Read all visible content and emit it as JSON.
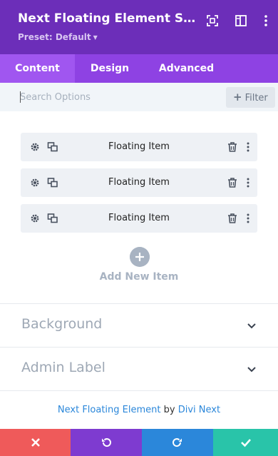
{
  "header": {
    "title": "Next Floating Element Settings",
    "preset": "Preset: Default",
    "icons": [
      "expand-icon",
      "sidebar-toggle-icon",
      "more-vertical-icon"
    ]
  },
  "tabs": [
    {
      "label": "Content",
      "active": true
    },
    {
      "label": "Design",
      "active": false
    },
    {
      "label": "Advanced",
      "active": false
    }
  ],
  "search": {
    "placeholder": "Search Options",
    "value": "",
    "filter_label": "Filter"
  },
  "items": [
    {
      "label": "Floating Item"
    },
    {
      "label": "Floating Item"
    },
    {
      "label": "Floating Item"
    }
  ],
  "add_new": {
    "label": "Add New Item"
  },
  "sections": [
    {
      "title": "Background"
    },
    {
      "title": "Admin Label"
    }
  ],
  "credit": {
    "name": "Next Floating Element",
    "by": "by",
    "author": "Divi Next"
  },
  "footer": {
    "buttons": [
      {
        "name": "cancel",
        "color": "#ef5a5a"
      },
      {
        "name": "undo",
        "color": "#7e3bd0"
      },
      {
        "name": "redo",
        "color": "#2b87da"
      },
      {
        "name": "save",
        "color": "#29c4a9"
      }
    ]
  },
  "colors": {
    "header": "#6c2eb9",
    "tabs": "#8e42e3",
    "active_tab": "#a056f0",
    "link": "#2b87da"
  }
}
